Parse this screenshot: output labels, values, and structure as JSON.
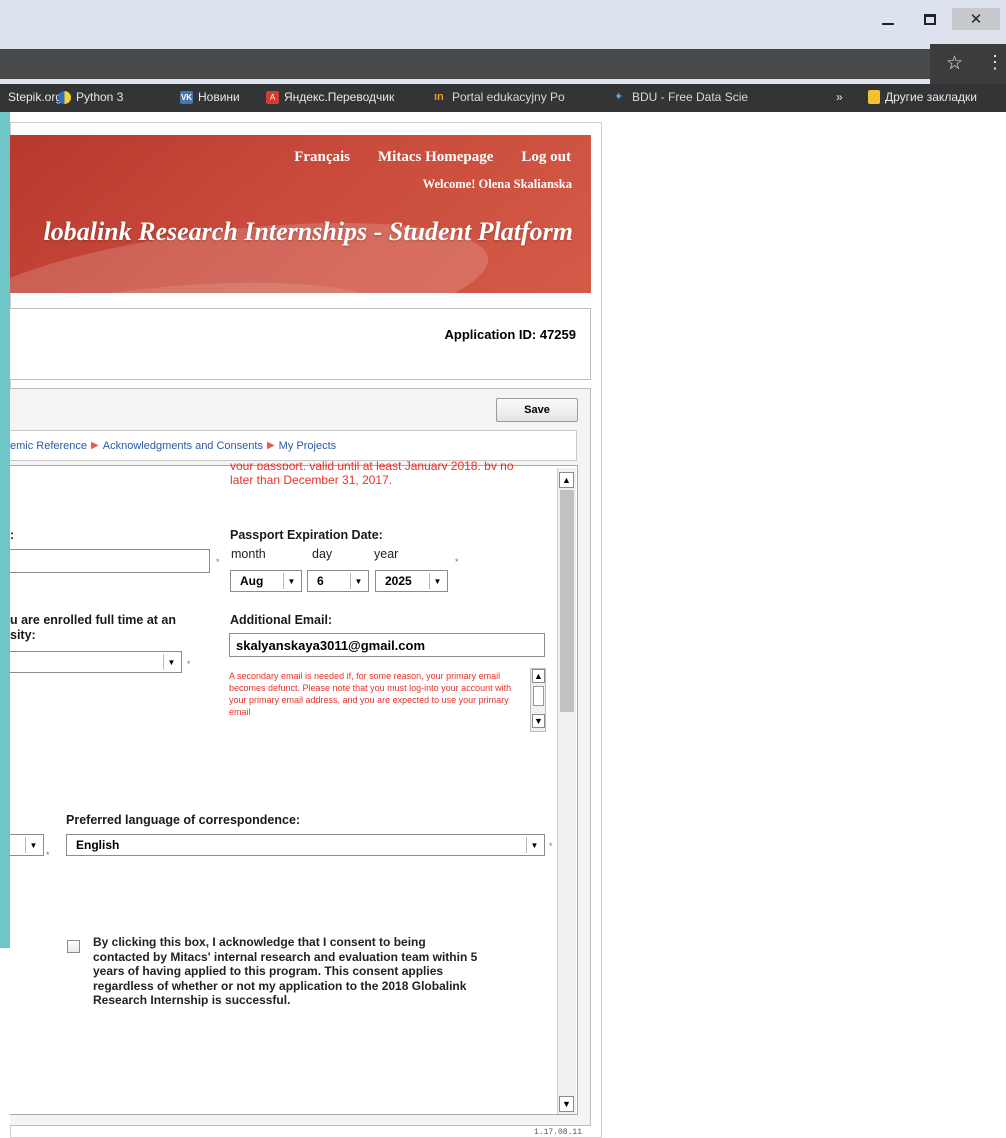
{
  "browser": {
    "window_controls": {
      "minimize": "minimize",
      "maximize": "maximize",
      "close": "✕"
    },
    "bookmarks": [
      {
        "label": "Stepik.org"
      },
      {
        "label": "Python 3"
      },
      {
        "label": "Новини",
        "icon_text": "VK"
      },
      {
        "label": "Яндекс.Переводчик",
        "icon_text": "A"
      },
      {
        "label": "Portal edukacyjny Po",
        "icon_text": "ın"
      },
      {
        "label": "BDU - Free Data Scie",
        "icon_text": "✦"
      },
      {
        "label": "»"
      },
      {
        "label": "Другие закладки"
      }
    ],
    "star_glyph": "☆",
    "menu_glyph": "⋮"
  },
  "header": {
    "nav": [
      "Français",
      "Mitacs Homepage",
      "Log out"
    ],
    "welcome": "Welcome! Olena Skalianska",
    "title": "lobalink Research Internships - Student Platform"
  },
  "application": {
    "id_text": "Application ID:  47259"
  },
  "toolbar": {
    "save_label": "Save"
  },
  "breadcrumbs": [
    "emic Reference",
    "Acknowledgments and Consents",
    "My Projects"
  ],
  "breadcrumb_arrow": "▶",
  "form": {
    "passport_note_cut": "your passport, valid until at least January 2018, by no",
    "passport_note": "later than December 31, 2017.",
    "left_label_cut": ":",
    "passport_label": "Passport Expiration Date:",
    "date_headers": {
      "month": "month",
      "day": "day",
      "year": "year"
    },
    "passport_month": "Aug",
    "passport_day": "6",
    "passport_year": "2025",
    "enrolled_label_line1": "u are enrolled full time at an",
    "enrolled_label_line2": "sity:",
    "additional_email_label": "Additional Email:",
    "additional_email_value": "skalyanskaya3011@gmail.com",
    "email_note": "A secondary email is needed if, for some reason, your primary email becomes defunct. Please note that you must log-into your account with your primary email address, and you are expected to use your primary email",
    "language_label": "Preferred language of correspondence:",
    "language_value": "English",
    "consent_text": "By clicking this box, I acknowledge that I consent to being contacted by Mitacs' internal research and evaluation team within 5 years of having applied to this program.  This consent applies regardless of whether or not my application to the 2018 Globalink Research Internship is successful.",
    "required_mark": "*",
    "dropdown_glyph": "▼",
    "scroll_up_glyph": "▲",
    "scroll_down_glyph": "▼"
  },
  "footer": {
    "version": "1.17.08.11"
  }
}
